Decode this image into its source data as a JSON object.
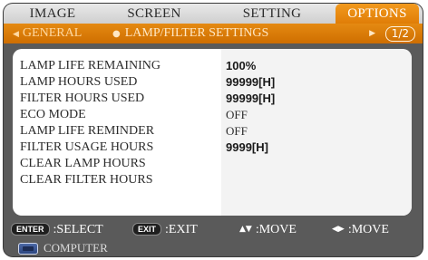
{
  "tabs": [
    {
      "label": "IMAGE",
      "active": false
    },
    {
      "label": "SCREEN",
      "active": false
    },
    {
      "label": "SETTING",
      "active": false
    },
    {
      "label": "OPTIONS",
      "active": true
    }
  ],
  "subtabs": {
    "general_label": "GENERAL",
    "lamp_label": "LAMP/FILTER SETTINGS",
    "page_indicator": "1/2",
    "left_arrow_icon": "triangle-left-icon",
    "right_arrow_icon": "triangle-right-icon"
  },
  "rows": [
    {
      "label": "LAMP LIFE REMAINING",
      "value": "100%"
    },
    {
      "label": "LAMP HOURS USED",
      "value": "99999[H]"
    },
    {
      "label": "FILTER HOURS USED",
      "value": "99999[H]"
    },
    {
      "label": "ECO MODE",
      "value": "OFF"
    },
    {
      "label": "LAMP LIFE REMINDER",
      "value": "OFF"
    },
    {
      "label": "FILTER USAGE HOURS",
      "value": "9999[H]"
    },
    {
      "label": "CLEAR LAMP HOURS",
      "value": ""
    },
    {
      "label": "CLEAR FILTER HOURS",
      "value": ""
    }
  ],
  "footer": {
    "enter_key": "ENTER",
    "select_label": ":SELECT",
    "exit_key": "EXIT",
    "exit_label": ":EXIT",
    "move_vertical_label": ":MOVE",
    "move_horizontal_label": ":MOVE"
  },
  "source": {
    "label": "COMPUTER",
    "icon": "computer-input-icon"
  },
  "colors": {
    "accent": "#e07d07",
    "frame": "#5a5a5a",
    "panel": "#ffffff"
  }
}
